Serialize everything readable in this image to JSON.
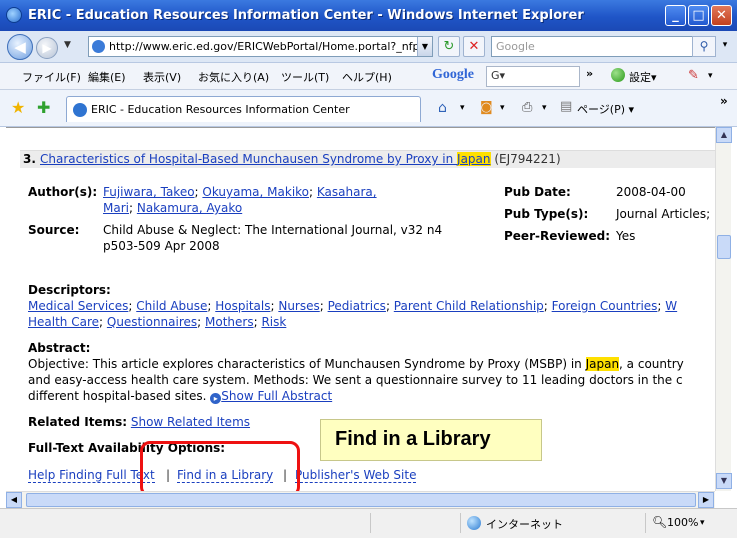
{
  "window": {
    "title": "ERIC - Education Resources Information Center - Windows Internet Explorer",
    "minimize_label": "_",
    "maximize_label": "□",
    "close_label": "✕"
  },
  "nav": {
    "address": "http://www.eric.ed.gov/ERICWebPortal/Home.portal?_nfpb=t",
    "search_placeholder": "Google"
  },
  "menu": {
    "items": [
      "ファイル(F)",
      "編集(E)",
      "表示(V)",
      "お気に入り(A)",
      "ツール(T)",
      "ヘルプ(H)"
    ],
    "google_label": "Google",
    "google_box": "G▾",
    "settings_label": "設定▾",
    "more_label": "»"
  },
  "tabs": {
    "active": "ERIC - Education Resources Information Center",
    "page_label": "ページ(P) ▾"
  },
  "record": {
    "number": "3.",
    "title": "Characteristics of Hospital-Based Munchausen Syndrome by Proxy in ",
    "title_highlight": "Japan",
    "id": "(EJ794221)",
    "authors_label": "Author(s):",
    "authors": [
      "Fujiwara, Takeo",
      "Okuyama, Makiko",
      "Kasahara,",
      "Mari",
      "Nakamura, Ayako"
    ],
    "source_label": "Source:",
    "source_line1": "Child Abuse & Neglect: The International Journal, v32 n4",
    "source_line2": "p503-509 Apr 2008",
    "pub_date_label": "Pub Date:",
    "pub_date": "2008-04-00",
    "pub_type_label": "Pub Type(s):",
    "pub_type": "Journal Articles;",
    "peer_label": "Peer-Reviewed:",
    "peer": "Yes",
    "descriptors_label": "Descriptors:",
    "descriptors_line1": [
      "Medical Services",
      "Child Abuse",
      "Hospitals",
      "Nurses",
      "Pediatrics",
      "Parent Child Relationship",
      "Foreign Countries",
      "W"
    ],
    "descriptors_line2": [
      "Health Care",
      "Questionnaires",
      "Mothers",
      "Risk"
    ],
    "abstract_label": "Abstract:",
    "abstract_line1_a": "Objective: This article explores characteristics of Munchausen Syndrome by Proxy (MSBP) in ",
    "abstract_line1_hl": "Japan",
    "abstract_line1_b": ", a country",
    "abstract_line2": "and easy-access health care system. Methods: We sent a questionnaire survey to 11 leading doctors in the c",
    "abstract_line3": "different hospital-based sites.",
    "show_full_abstract": "Show Full Abstract",
    "related_label": "Related Items:",
    "related_link": "Show Related Items",
    "fulltext_label": "Full-Text Availability Options:",
    "ft_links": [
      "Help Finding Full Text",
      "Find in a Library",
      "Publisher's Web Site"
    ],
    "ft_sep": "|"
  },
  "callout": {
    "text": "Find in a Library"
  },
  "status": {
    "zone": "インターネット",
    "zoom": "100%"
  },
  "colors": {
    "link": "#1a3fbf",
    "highlight": "#ffe000",
    "callout_bg": "#ffffc0",
    "annotation_red": "#ee1111",
    "titlebar": "#1f55c7"
  }
}
